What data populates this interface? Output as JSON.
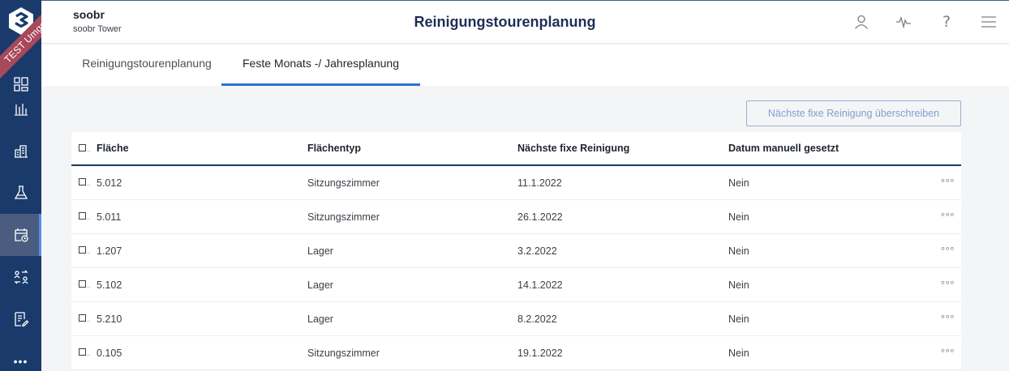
{
  "environment_ribbon": "TEST Umgebung",
  "header": {
    "tenant_name": "soobr",
    "tenant_site": "soobr Tower",
    "title": "Reinigungstourenplanung",
    "icons": [
      "user-icon",
      "activity-icon",
      "help-icon",
      "hamburger-menu-icon"
    ],
    "help_glyph": "?"
  },
  "sidebar": {
    "items": [
      {
        "icon": "dashboard-icon"
      },
      {
        "icon": "bar-chart-icon"
      },
      {
        "icon": "buildings-icon"
      },
      {
        "icon": "flask-icon"
      },
      {
        "icon": "calendar-clock-icon",
        "active": true
      },
      {
        "icon": "swap-people-icon"
      },
      {
        "icon": "document-edit-icon"
      },
      {
        "icon": "more-icon",
        "glyph": "•••"
      }
    ]
  },
  "tabs": [
    {
      "label": "Reinigungstourenplanung",
      "active": false
    },
    {
      "label": "Feste Monats -/ Jahresplanung",
      "active": true
    }
  ],
  "override_button_label": "Nächste fixe Reinigung überschreiben",
  "table": {
    "columns": [
      "Fläche",
      "Flächentyp",
      "Nächste fixe Reinigung",
      "Datum manuell gesetzt"
    ],
    "checkbox_suffix": "..",
    "row_menu": "°°°",
    "rows": [
      {
        "area": "5.012",
        "type": "Sitzungszimmer",
        "next": "11.1.2022",
        "manual": "Nein"
      },
      {
        "area": "5.011",
        "type": "Sitzungszimmer",
        "next": "26.1.2022",
        "manual": "Nein"
      },
      {
        "area": "1.207",
        "type": "Lager",
        "next": "3.2.2022",
        "manual": "Nein"
      },
      {
        "area": "5.102",
        "type": "Lager",
        "next": "14.1.2022",
        "manual": "Nein"
      },
      {
        "area": "5.210",
        "type": "Lager",
        "next": "8.2.2022",
        "manual": "Nein"
      },
      {
        "area": "0.105",
        "type": "Sitzungszimmer",
        "next": "19.1.2022",
        "manual": "Nein"
      }
    ]
  },
  "colors": {
    "sidebar": "#1a3a6b",
    "accent": "#2f6fd6",
    "ribbon": "#a8495b",
    "title": "#1c2f55"
  }
}
